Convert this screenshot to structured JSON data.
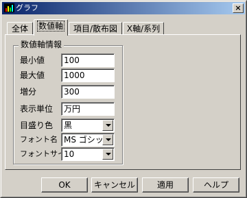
{
  "window": {
    "title": "グラフ",
    "close_label": "×"
  },
  "tabs": [
    {
      "label": "全体",
      "active": false
    },
    {
      "label": "数値軸",
      "active": true
    },
    {
      "label": "項目/散布図",
      "active": false
    },
    {
      "label": "X軸/系列",
      "active": false
    }
  ],
  "group": {
    "title": "数値軸情報",
    "fields": {
      "min_label": "最小値",
      "min_value": "100",
      "max_label": "最大値",
      "max_value": "1000",
      "step_label": "増分",
      "step_value": "300",
      "unit_label": "表示単位",
      "unit_value": "万円",
      "tick_color_label": "目盛り色",
      "tick_color_value": "黒",
      "font_name_label": "フォント名",
      "font_name_value": "MS ゴシック",
      "font_size_label": "フォントサイズ",
      "font_size_value": "10"
    }
  },
  "buttons": {
    "ok": "OK",
    "cancel": "キャンセル",
    "apply": "適用",
    "help": "ヘルプ"
  },
  "colors": {
    "title_start": "#0a246a",
    "title_end": "#a6caf0",
    "face": "#d4d0c8"
  }
}
